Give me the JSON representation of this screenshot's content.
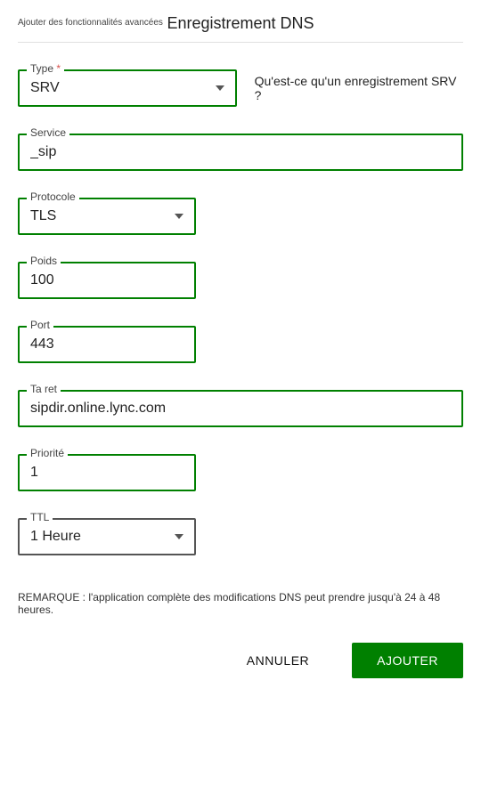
{
  "header": {
    "subtitle": "Ajouter des fonctionnalités avancées",
    "title": "Enregistrement DNS"
  },
  "fields": {
    "type": {
      "label": "Type",
      "value": "SRV",
      "required": true
    },
    "type_help": "Qu'est-ce qu'un enregistrement SRV ?",
    "service": {
      "label": "Service",
      "value": "_sip"
    },
    "protocole": {
      "label": "Protocole",
      "value": "TLS"
    },
    "poids": {
      "label": "Poids",
      "value": "100"
    },
    "port": {
      "label": "Port",
      "value": "443"
    },
    "target": {
      "label": "Ta ret",
      "value": "sipdir.online.lync.com"
    },
    "priorite": {
      "label": "Priorité",
      "value": "1"
    },
    "ttl": {
      "label": "TTL",
      "value": "1 Heure"
    }
  },
  "note": "REMARQUE : l'application complète des modifications DNS peut prendre jusqu'à 24 à 48 heures.",
  "buttons": {
    "cancel": "ANNULER",
    "add": "AJOUTER"
  }
}
